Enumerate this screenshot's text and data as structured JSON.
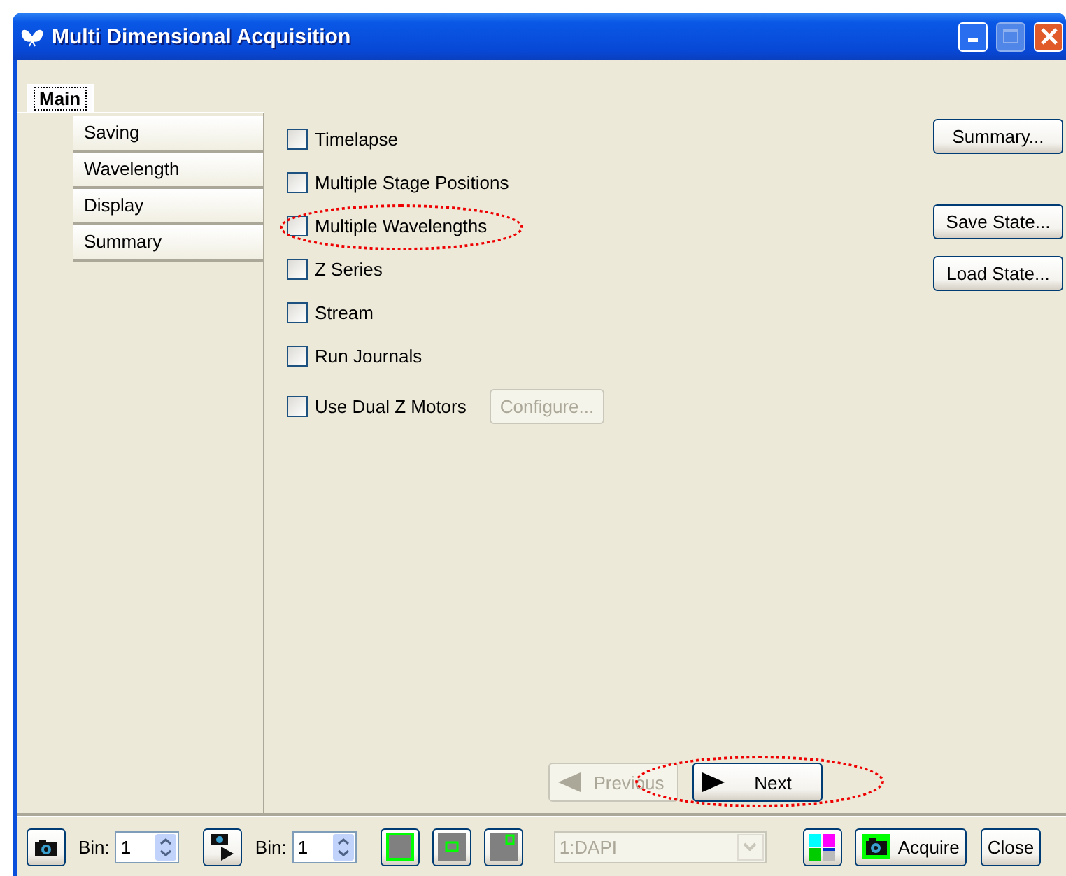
{
  "window": {
    "title": "Multi Dimensional Acquisition"
  },
  "tabs": [
    {
      "label": "Main",
      "selected": true
    },
    {
      "label": "Saving",
      "selected": false
    },
    {
      "label": "Wavelength",
      "selected": false
    },
    {
      "label": "Display",
      "selected": false
    },
    {
      "label": "Summary",
      "selected": false
    }
  ],
  "options": [
    {
      "label": "Timelapse",
      "checked": false,
      "highlighted": false
    },
    {
      "label": "Multiple Stage Positions",
      "checked": false,
      "highlighted": false
    },
    {
      "label": "Multiple Wavelengths",
      "checked": false,
      "highlighted": true
    },
    {
      "label": "Z Series",
      "checked": false,
      "highlighted": false
    },
    {
      "label": "Stream",
      "checked": false,
      "highlighted": false
    },
    {
      "label": "Run Journals",
      "checked": false,
      "highlighted": false
    },
    {
      "label": "Use Dual Z Motors",
      "checked": false,
      "highlighted": false,
      "button": {
        "label": "Configure...",
        "disabled": true
      }
    }
  ],
  "side_buttons": [
    {
      "label": "Summary..."
    },
    {
      "label": "Save State..."
    },
    {
      "label": "Load State..."
    }
  ],
  "navigation": [
    {
      "label": "Previous",
      "disabled": true,
      "highlighted": false
    },
    {
      "label": "Next",
      "disabled": false,
      "highlighted": true
    }
  ],
  "toolbar": [
    {
      "kind": "icon-button"
    },
    {
      "kind": "spin",
      "label": "Bin:",
      "value": "1"
    },
    {
      "kind": "icon-button"
    },
    {
      "kind": "spin",
      "label": "Bin:",
      "value": "1"
    },
    {
      "kind": "icon-button"
    },
    {
      "kind": "icon-button"
    },
    {
      "kind": "icon-button"
    },
    {
      "kind": "dropdown",
      "value": "1:DAPI",
      "disabled": true
    },
    {
      "kind": "icon-button"
    },
    {
      "kind": "button",
      "label": "Acquire"
    },
    {
      "kind": "button",
      "label": "Close"
    }
  ]
}
